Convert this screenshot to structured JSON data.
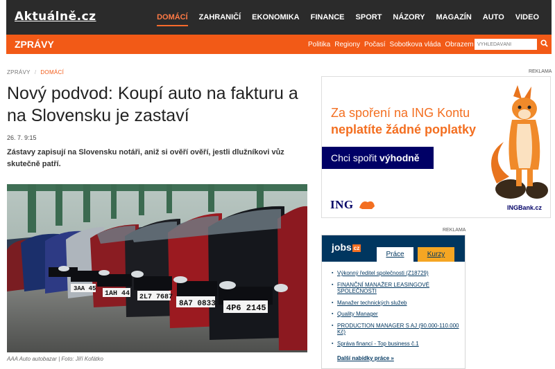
{
  "header": {
    "logo": "Aktuálně.cz",
    "nav": [
      "DOMÁCÍ",
      "ZAHRANIČÍ",
      "EKONOMIKA",
      "FINANCE",
      "SPORT",
      "NÁZORY",
      "MAGAZÍN",
      "AUTO",
      "VIDEO"
    ],
    "active_nav": "DOMÁCÍ"
  },
  "subbar": {
    "section": "ZPRÁVY",
    "links": [
      "Politika",
      "Regiony",
      "Počasí",
      "Sobotkova vláda",
      "Obrazem"
    ],
    "search_placeholder": "VYHLEDÁVÁNÍ"
  },
  "article": {
    "breadcrumb": [
      "ZPRÁVY",
      "DOMÁCÍ"
    ],
    "title": "Nový podvod: Koupí auto na fakturu a na Slovensku je zastaví",
    "date": "26. 7. 9:15",
    "perex": "Zástavy zapisují na Slovensku notáři, aniž si ověří ověří, jestli dlužníkovi vůz skutečně patří.",
    "photo_caption": "AAA Auto autobazar | Foto: Jiří Kofátko",
    "plates": [
      "3AA 45",
      "1AH 44",
      "2L7 7687",
      "8A7 0833",
      "4P6 2145"
    ]
  },
  "ads": {
    "label": "REKLAMA",
    "ing": {
      "line1": "Za spoření na ING Kontu",
      "line2": "neplatíte žádné poplatky",
      "button_plain": "Chci spořit ",
      "button_bold": "výhodně",
      "logo": "ING",
      "url": "INGBank.cz"
    }
  },
  "jobs": {
    "logo": "jobs",
    "logo_suffix": "cz",
    "tabs": [
      "Práce",
      "Kurzy"
    ],
    "items": [
      "Výkonný ředitel společnosti (Z18729)",
      "FINANČNÍ MANAŽER LEASINGOVÉ SPOLEČNOSTI",
      "Manažer technických služeb",
      "Quality Manager",
      "PRODUCTION MANAGER S AJ (90.000-110.000 Kč)",
      "Správa financí - Top business č.1"
    ],
    "more": "Další nabídky práce »"
  },
  "colors": {
    "topbar": "#2b2b2b",
    "accent": "#f25a17",
    "ing_orange": "#f36f21",
    "ing_blue": "#000066",
    "jobs_blue": "#00365f"
  }
}
